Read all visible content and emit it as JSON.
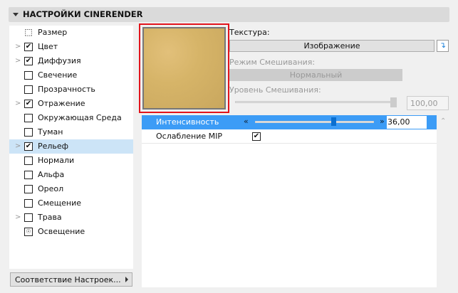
{
  "header": {
    "title": "НАСТРОЙКИ CINERENDER"
  },
  "list": {
    "items": [
      {
        "label": "Размер",
        "type": "size",
        "checked": null,
        "expandable": false
      },
      {
        "label": "Цвет",
        "checked": true,
        "expandable": true
      },
      {
        "label": "Диффузия",
        "checked": true,
        "expandable": true
      },
      {
        "label": "Свечение",
        "checked": false,
        "expandable": false
      },
      {
        "label": "Прозрачность",
        "checked": false,
        "expandable": false
      },
      {
        "label": "Отражение",
        "checked": true,
        "expandable": true
      },
      {
        "label": "Окружающая Среда",
        "checked": false,
        "expandable": false
      },
      {
        "label": "Туман",
        "checked": false,
        "expandable": false
      },
      {
        "label": "Рельеф",
        "checked": true,
        "expandable": true,
        "selected": true
      },
      {
        "label": "Нормали",
        "checked": false,
        "expandable": false
      },
      {
        "label": "Альфа",
        "checked": false,
        "expandable": false
      },
      {
        "label": "Ореол",
        "checked": false,
        "expandable": false
      },
      {
        "label": "Смещение",
        "checked": false,
        "expandable": false
      },
      {
        "label": "Трава",
        "checked": false,
        "expandable": true
      },
      {
        "label": "Освещение",
        "type": "light",
        "checked": null,
        "expandable": false
      }
    ]
  },
  "match_button": "Соответствие Настроек...",
  "texture": {
    "label": "Текстура:",
    "value": "Изображение"
  },
  "blend_mode": {
    "label": "Режим Смешивания:",
    "value": "Нормальный"
  },
  "blend_level": {
    "label": "Уровень Смешивания:",
    "value": "100,00",
    "fraction": 1.0
  },
  "params": [
    {
      "label": "Интенсивность",
      "value": "36,00",
      "fraction": 0.66
    },
    {
      "label": "Ослабление MIP",
      "checked": true
    }
  ],
  "colors": {
    "accent": "#3c9cf6",
    "highlight": "#e2141c"
  }
}
